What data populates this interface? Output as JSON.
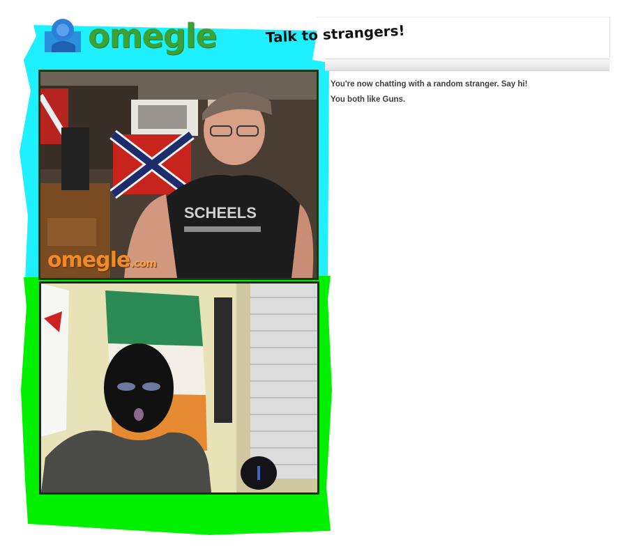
{
  "header": {
    "logo_text": "omegle",
    "tagline": "Talk to strangers!"
  },
  "stranger_video": {
    "watermark_text": "omegle",
    "watermark_suffix": ".com",
    "shirt_text": "SCHEELS"
  },
  "chat": {
    "messages": [
      "You're now chatting with a random stranger. Say hi!",
      "You both like Guns."
    ]
  },
  "colors": {
    "highlight_cyan": "#1ff0ff",
    "highlight_green": "#00f000",
    "logo_green": "#3ba236",
    "logo_blue": "#2d7fd8",
    "watermark_orange": "#f08a24"
  },
  "icons": {
    "logo_mark": "omegle-logo-icon"
  }
}
